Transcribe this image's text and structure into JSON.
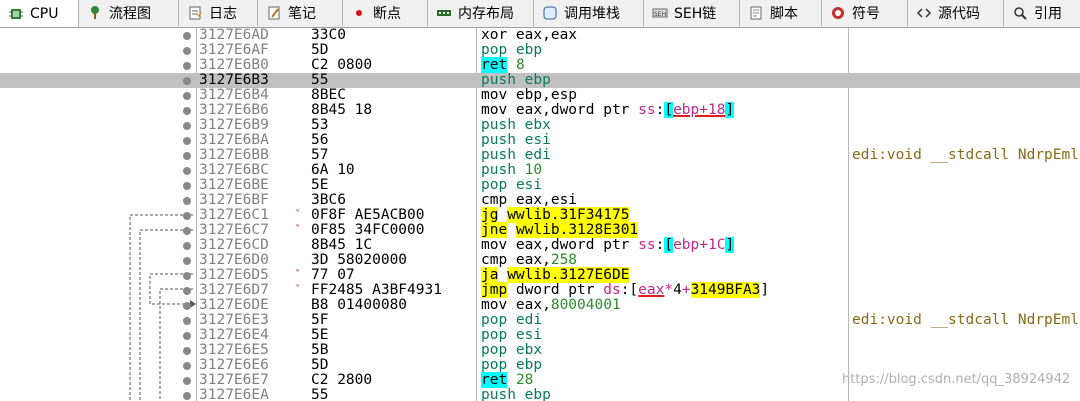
{
  "tabs": [
    {
      "label": "CPU",
      "icon": "cpu-icon",
      "active": true,
      "w": 79
    },
    {
      "label": "流程图",
      "icon": "flowchart-icon",
      "active": false,
      "w": 100
    },
    {
      "label": "日志",
      "icon": "log-icon",
      "active": false,
      "w": 79
    },
    {
      "label": "笔记",
      "icon": "notes-icon",
      "active": false,
      "w": 85
    },
    {
      "label": "断点",
      "icon": "breakpoint-icon",
      "active": false,
      "w": 85
    },
    {
      "label": "内存布局",
      "icon": "memory-map-icon",
      "active": false,
      "w": 106
    },
    {
      "label": "调用堆栈",
      "icon": "call-stack-icon",
      "active": false,
      "w": 110
    },
    {
      "label": "SEH链",
      "icon": "seh-chain-icon",
      "active": false,
      "w": 96
    },
    {
      "label": "脚本",
      "icon": "script-icon",
      "active": false,
      "w": 82
    },
    {
      "label": "符号",
      "icon": "symbols-icon",
      "active": false,
      "w": 86
    },
    {
      "label": "源代码",
      "icon": "source-code-icon",
      "active": false,
      "w": 96
    },
    {
      "label": "引用",
      "icon": "references-icon",
      "active": false,
      "w": 80
    }
  ],
  "rows": [
    {
      "addr": "3127E6AD",
      "bytes": "33C0",
      "chev": "",
      "disasm": [
        {
          "t": "xor eax,eax"
        }
      ],
      "comment": ""
    },
    {
      "addr": "3127E6AF",
      "bytes": "5D",
      "chev": "",
      "disasm": [
        {
          "t": "pop ebp",
          "c": "pop"
        }
      ],
      "comment": ""
    },
    {
      "addr": "3127E6B0",
      "bytes": "C2 0800",
      "chev": "",
      "disasm": [
        {
          "t": "ret",
          "c": "ret"
        },
        {
          "t": " "
        },
        {
          "t": "8",
          "c": "num"
        }
      ],
      "comment": ""
    },
    {
      "addr": "3127E6B3",
      "bytes": "55",
      "chev": "",
      "hl": true,
      "disasm": [
        {
          "t": "push ebp",
          "c": "push"
        }
      ],
      "comment": ""
    },
    {
      "addr": "3127E6B4",
      "bytes": "8BEC",
      "chev": "",
      "disasm": [
        {
          "t": "mov ebp,esp"
        }
      ],
      "comment": ""
    },
    {
      "addr": "3127E6B6",
      "bytes": "8B45 18",
      "chev": "",
      "disasm": [
        {
          "t": "mov eax,dword ptr "
        },
        {
          "t": "ss",
          "c": "seg"
        },
        {
          "t": ":"
        },
        {
          "t": "[",
          "c": "brk"
        },
        {
          "t": "ebp+18",
          "c": "seg",
          "u": true
        },
        {
          "t": "]",
          "c": "brk"
        }
      ],
      "comment": ""
    },
    {
      "addr": "3127E6B9",
      "bytes": "53",
      "chev": "",
      "disasm": [
        {
          "t": "push ebx",
          "c": "push"
        }
      ],
      "comment": ""
    },
    {
      "addr": "3127E6BA",
      "bytes": "56",
      "chev": "",
      "disasm": [
        {
          "t": "push esi",
          "c": "push"
        }
      ],
      "comment": ""
    },
    {
      "addr": "3127E6BB",
      "bytes": "57",
      "chev": "",
      "disasm": [
        {
          "t": "push edi",
          "c": "push"
        }
      ],
      "comment": "edi:void __stdcall NdrpEml"
    },
    {
      "addr": "3127E6BC",
      "bytes": "6A 10",
      "chev": "",
      "disasm": [
        {
          "t": "push",
          "c": "push"
        },
        {
          "t": " "
        },
        {
          "t": "10",
          "c": "num"
        }
      ],
      "comment": ""
    },
    {
      "addr": "3127E6BE",
      "bytes": "5E",
      "chev": "",
      "disasm": [
        {
          "t": "pop esi",
          "c": "pop"
        }
      ],
      "comment": ""
    },
    {
      "addr": "3127E6BF",
      "bytes": "3BC6",
      "chev": "",
      "disasm": [
        {
          "t": "cmp eax,esi"
        }
      ],
      "comment": ""
    },
    {
      "addr": "3127E6C1",
      "bytes": "0F8F AE5ACB00",
      "chev": "ˇ",
      "disasm": [
        {
          "t": "jg",
          "c": "jump"
        },
        {
          "t": " "
        },
        {
          "t": "wwlib.31F34175",
          "c": "target"
        }
      ],
      "comment": ""
    },
    {
      "addr": "3127E6C7",
      "bytes": "0F85 34FC0000",
      "chev": "ˇ",
      "disasm": [
        {
          "t": "jne",
          "c": "jump"
        },
        {
          "t": " "
        },
        {
          "t": "wwlib.3128E301",
          "c": "target"
        }
      ],
      "comment": ""
    },
    {
      "addr": "3127E6CD",
      "bytes": "8B45 1C",
      "chev": "",
      "disasm": [
        {
          "t": "mov eax,dword ptr "
        },
        {
          "t": "ss",
          "c": "seg"
        },
        {
          "t": ":"
        },
        {
          "t": "[",
          "c": "brk"
        },
        {
          "t": "ebp+1C",
          "c": "seg"
        },
        {
          "t": "]",
          "c": "brk"
        }
      ],
      "comment": ""
    },
    {
      "addr": "3127E6D0",
      "bytes": "3D 58020000",
      "chev": "",
      "disasm": [
        {
          "t": "cmp eax,"
        },
        {
          "t": "258",
          "c": "num"
        }
      ],
      "comment": ""
    },
    {
      "addr": "3127E6D5",
      "bytes": "77 07",
      "chev": "ˇ",
      "disasm": [
        {
          "t": "ja",
          "c": "jump"
        },
        {
          "t": " "
        },
        {
          "t": "wwlib.3127E6DE",
          "c": "target"
        }
      ],
      "comment": ""
    },
    {
      "addr": "3127E6D7",
      "bytes": "FF2485 A3BF4931",
      "chev": "ˇ",
      "disasm": [
        {
          "t": "jmp",
          "c": "jump"
        },
        {
          "t": " dword ptr "
        },
        {
          "t": "ds",
          "c": "seg"
        },
        {
          "t": ":["
        },
        {
          "t": "eax",
          "c": "seg",
          "u": true
        },
        {
          "t": "*",
          "c": "op"
        },
        {
          "t": "4"
        },
        {
          "t": "+",
          "c": "op"
        },
        {
          "t": "3149BFA3",
          "c": "target"
        },
        {
          "t": "]"
        }
      ],
      "comment": ""
    },
    {
      "addr": "3127E6DE",
      "bytes": "B8 01400080",
      "chev": "",
      "disasm": [
        {
          "t": "mov eax,"
        },
        {
          "t": "80004001",
          "c": "num"
        }
      ],
      "comment": ""
    },
    {
      "addr": "3127E6E3",
      "bytes": "5F",
      "chev": "",
      "disasm": [
        {
          "t": "pop edi",
          "c": "pop"
        }
      ],
      "comment": "edi:void __stdcall NdrpEml"
    },
    {
      "addr": "3127E6E4",
      "bytes": "5E",
      "chev": "",
      "disasm": [
        {
          "t": "pop esi",
          "c": "pop"
        }
      ],
      "comment": ""
    },
    {
      "addr": "3127E6E5",
      "bytes": "5B",
      "chev": "",
      "disasm": [
        {
          "t": "pop ebx",
          "c": "pop"
        }
      ],
      "comment": ""
    },
    {
      "addr": "3127E6E6",
      "bytes": "5D",
      "chev": "",
      "disasm": [
        {
          "t": "pop ebp",
          "c": "pop"
        }
      ],
      "comment": ""
    },
    {
      "addr": "3127E6E7",
      "bytes": "C2 2800",
      "chev": "",
      "disasm": [
        {
          "t": "ret",
          "c": "ret"
        },
        {
          "t": " "
        },
        {
          "t": "28",
          "c": "num"
        }
      ],
      "comment": ""
    },
    {
      "addr": "3127E6EA",
      "bytes": "55",
      "chev": "",
      "disasm": [
        {
          "t": "push ebp",
          "c": "push"
        }
      ],
      "comment": ""
    }
  ],
  "watermark": "https://blog.csdn.net/qq_38924942",
  "colors": {
    "ret_bg": "#00ffff",
    "jump_bg": "#ffff00",
    "highlight_row": "#c0c0c0",
    "comment": "#8a6a18"
  }
}
